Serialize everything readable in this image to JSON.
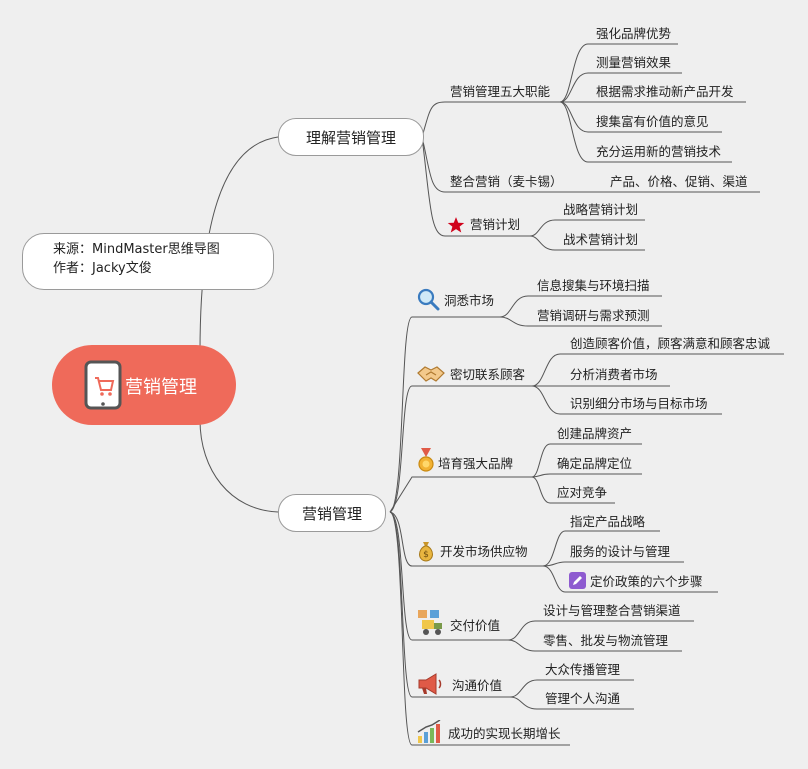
{
  "root": {
    "label": "营销管理",
    "icon": "tablet-cart-icon",
    "color": "#ef6a5a"
  },
  "note": {
    "line1": "来源：MindMaster思维导图",
    "line2": "作者：Jacky文俊"
  },
  "branches": {
    "understand": {
      "label": "理解营销管理",
      "five_functions": {
        "label": "营销管理五大职能",
        "items": [
          "强化品牌优势",
          "测量营销效果",
          "根据需求推动新产品开发",
          "搜集富有价值的意见",
          "充分运用新的营销技术"
        ]
      },
      "integrated": {
        "label": "整合营销（麦卡锡）",
        "items": [
          "产品、价格、促销、渠道"
        ]
      },
      "plan": {
        "label": "营销计划",
        "icon": "red-star-icon",
        "items": [
          "战略营销计划",
          "战术营销计划"
        ]
      }
    },
    "management": {
      "label": "营销管理",
      "insight": {
        "label": "洞悉市场",
        "icon": "magnifier-icon",
        "items": [
          "信息搜集与环境扫描",
          "营销调研与需求预测"
        ]
      },
      "connect": {
        "label": "密切联系顾客",
        "icon": "handshake-icon",
        "items": [
          "创造顾客价值，顾客满意和顾客忠诚",
          "分析消费者市场",
          "识别细分市场与目标市场"
        ]
      },
      "brand": {
        "label": "培育强大品牌",
        "icon": "medal-icon",
        "items": [
          "创建品牌资产",
          "确定品牌定位",
          "应对竞争"
        ]
      },
      "offer": {
        "label": "开发市场供应物",
        "icon": "money-bag-icon",
        "items": [
          "指定产品战略",
          "服务的设计与管理",
          "定价政策的六个步骤"
        ],
        "item_icon": "pencil-icon"
      },
      "deliver": {
        "label": "交付价值",
        "icon": "delivery-icon",
        "items": [
          "设计与管理整合营销渠道",
          "零售、批发与物流管理"
        ]
      },
      "communicate": {
        "label": "沟通价值",
        "icon": "megaphone-icon",
        "items": [
          "大众传播管理",
          "管理个人沟通"
        ]
      },
      "growth": {
        "label": "成功的实现长期增长",
        "icon": "growth-chart-icon"
      }
    }
  }
}
